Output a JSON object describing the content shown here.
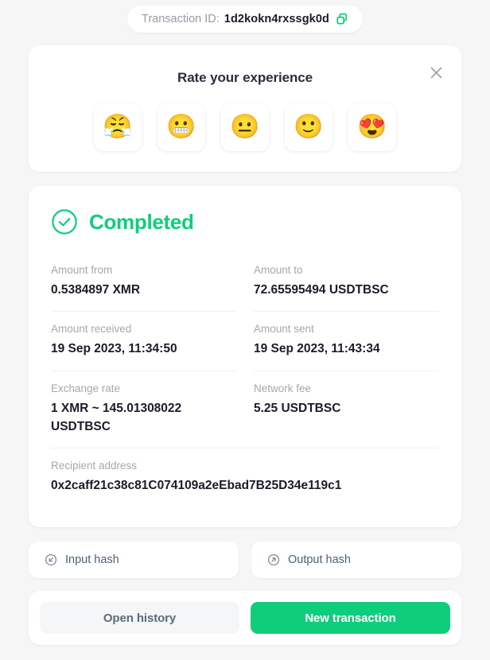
{
  "transaction": {
    "id_label": "Transaction ID:",
    "id_value": "1d2kokn4rxssgk0d",
    "copy_icon": "copy-icon"
  },
  "rating": {
    "title": "Rate your experience",
    "close_icon": "close-icon",
    "options": [
      {
        "name": "rating-1-angry",
        "emoji": "😤",
        "label": "Very bad"
      },
      {
        "name": "rating-2-grimacing",
        "emoji": "😬",
        "label": "Bad"
      },
      {
        "name": "rating-3-neutral",
        "emoji": "😐",
        "label": "Neutral"
      },
      {
        "name": "rating-4-smiling",
        "emoji": "🙂",
        "label": "Good"
      },
      {
        "name": "rating-5-heart-eyes",
        "emoji": "😍",
        "label": "Excellent"
      }
    ]
  },
  "status": {
    "text": "Completed",
    "icon": "check-circle-icon",
    "color": "#0ece7b"
  },
  "details": [
    {
      "label": "Amount from",
      "value": "0.5384897 XMR"
    },
    {
      "label": "Amount to",
      "value": "72.65595494 USDTBSC"
    },
    {
      "label": "Amount received",
      "value": "19 Sep 2023, 11:34:50"
    },
    {
      "label": "Amount sent",
      "value": "19 Sep 2023, 11:43:34"
    },
    {
      "label": "Exchange rate",
      "value": "1 XMR ~ 145.01308022 USDTBSC"
    },
    {
      "label": "Network fee",
      "value": "5.25 USDTBSC"
    },
    {
      "label": "Recipient address",
      "value": "0x2caff21c38c81C074109a2eEbad7B25D34e119c1"
    }
  ],
  "hashes": [
    {
      "label": "Input hash",
      "icon": "arrow-in-circle-icon"
    },
    {
      "label": "Output hash",
      "icon": "arrow-out-circle-icon"
    }
  ],
  "actions": {
    "history_label": "Open history",
    "new_transaction_label": "New transaction"
  }
}
